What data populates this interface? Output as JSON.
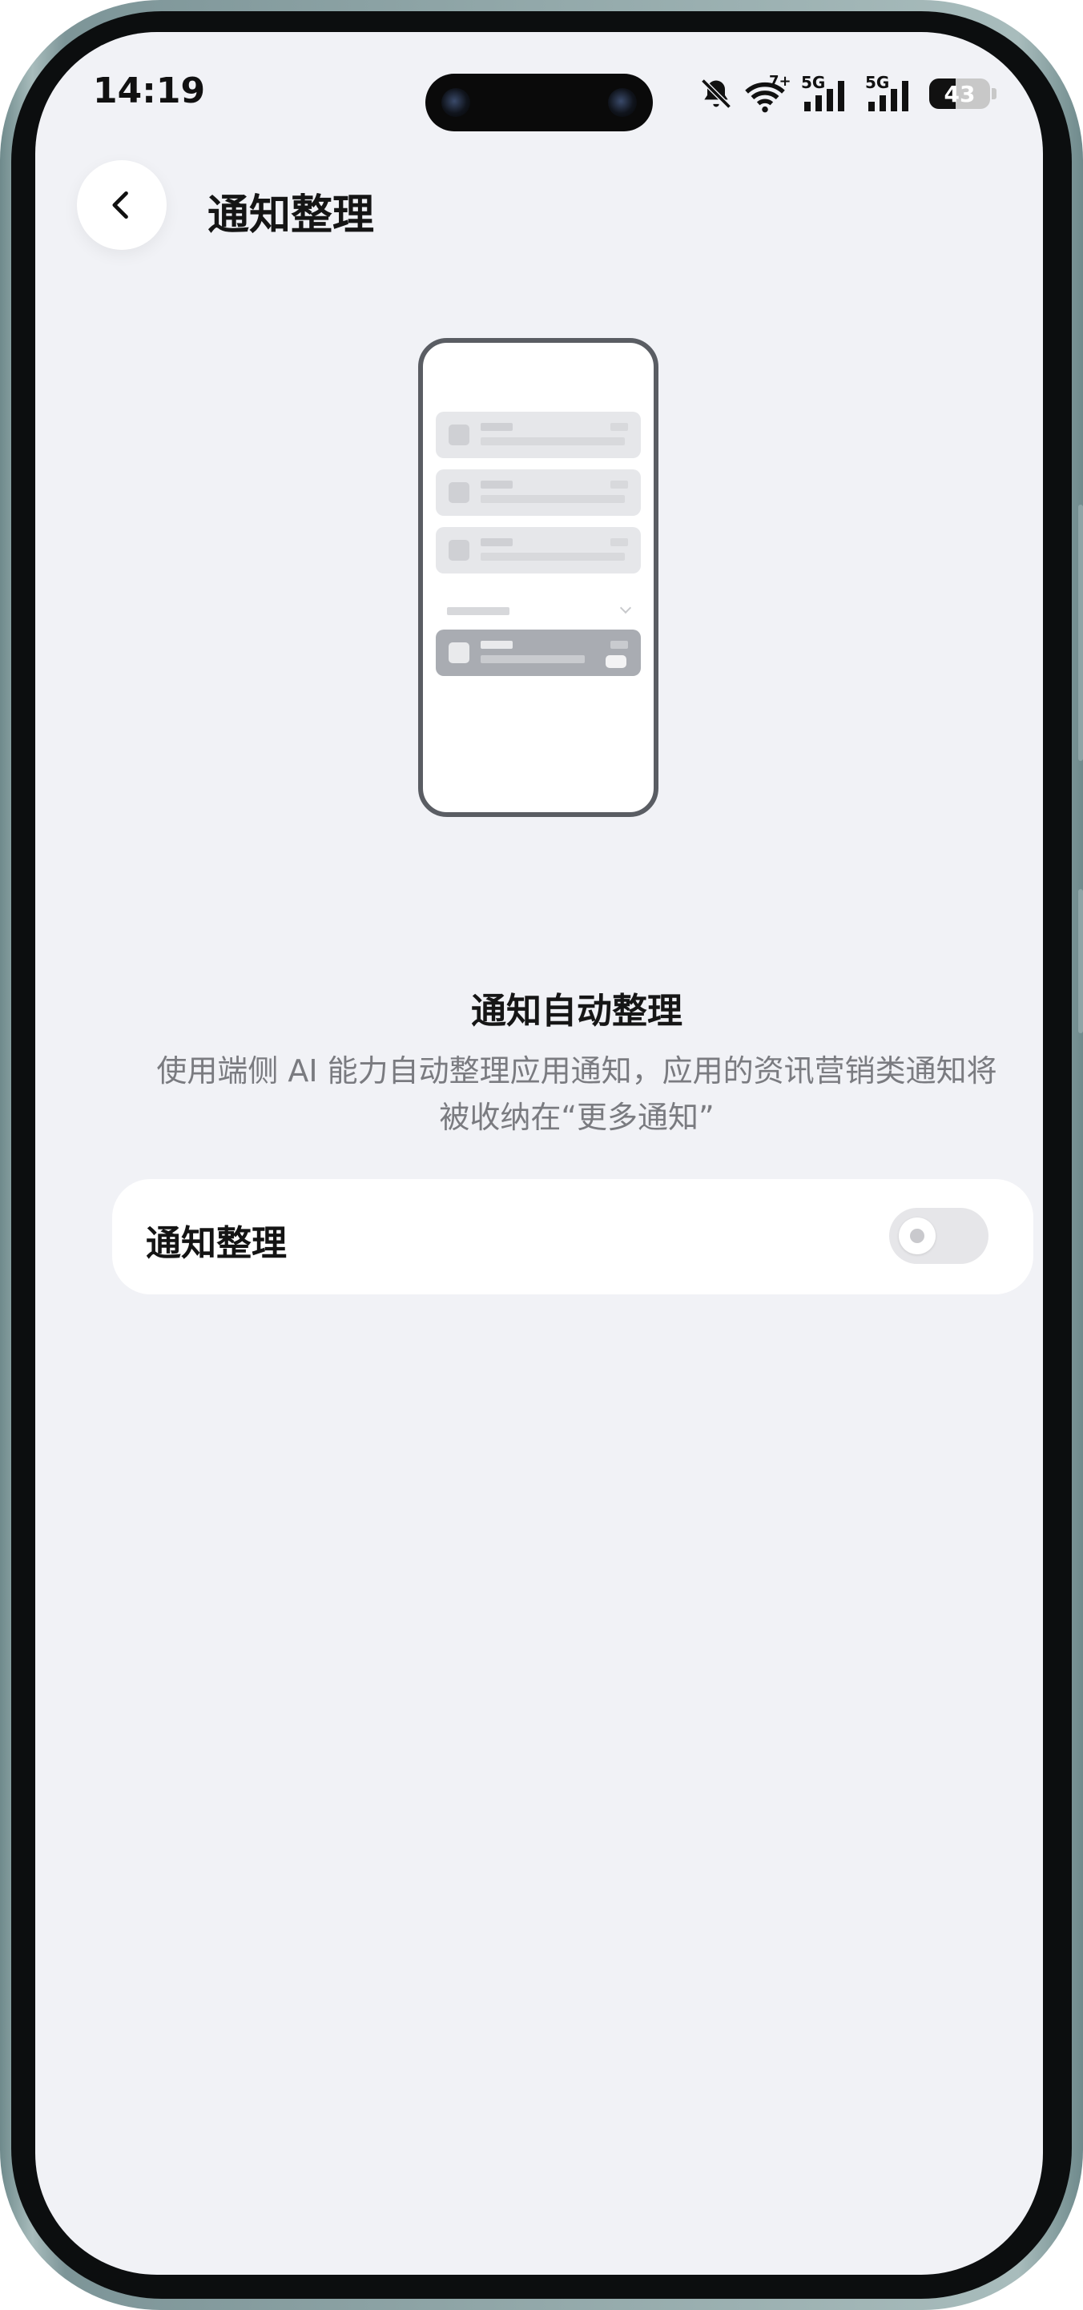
{
  "status_bar": {
    "time": "14:19",
    "network_small": "7+",
    "sim1": "5G",
    "sim2": "5G",
    "battery": "43",
    "icons": [
      "bell-muted-icon",
      "wifi-icon",
      "signal-icon",
      "signal-icon",
      "battery-icon"
    ]
  },
  "header": {
    "back_icon": "chevron-left-icon",
    "title": "通知整理"
  },
  "feature": {
    "title": "通知自动整理",
    "description": "使用端侧 AI 能力自动整理应用通知，应用的资讯营销类通知将被收纳在“更多通知”"
  },
  "setting": {
    "label": "通知整理",
    "enabled": false
  },
  "colors": {
    "background": "#f1f2f6",
    "card": "#ffffff",
    "toggle_off": "#e6e6e9",
    "secondary_text": "#7a7b80"
  }
}
